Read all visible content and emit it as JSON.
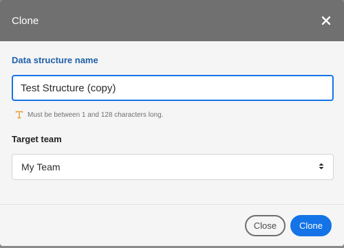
{
  "dialog": {
    "title": "Clone",
    "close_icon": "close-icon"
  },
  "name_field": {
    "label": "Data structure name",
    "value": "Test Structure (copy)",
    "helper_icon": "type-icon",
    "helper_text": "Must be between 1 and 128 characters long."
  },
  "team_field": {
    "label": "Target team",
    "selected": "My Team",
    "icon": "sort-arrows-icon"
  },
  "footer": {
    "close_label": "Close",
    "clone_label": "Clone"
  },
  "colors": {
    "header_bg": "#707070",
    "accent": "#1473e6",
    "label_blue": "#1f5fa8",
    "helper_icon": "#e8a13a"
  }
}
